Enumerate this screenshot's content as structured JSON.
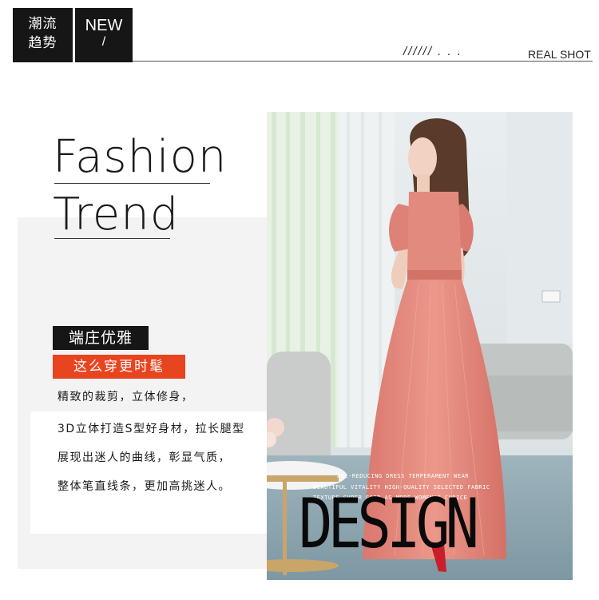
{
  "header": {
    "cn_tag_line1": "潮流",
    "cn_tag_line2": "趋势",
    "new_label": "NEW",
    "slash": "/",
    "dots": "////// . . .",
    "real_shot": "REAL SHOT"
  },
  "title": {
    "line1": "Fashion",
    "line2": "Trend"
  },
  "tags": {
    "black": "端庄优雅",
    "red": "这么穿更时髦"
  },
  "description": [
    "精致的裁剪，立体修身，",
    "3D立体打造S型好身材，拉长腿型",
    "展现出迷人的曲线，彰显气质，",
    "整体笔直线条，更加高挑迷人。"
  ],
  "photo": {
    "small_text": [
      "AGE-REDUCING DRESS  TEMPERAMENT WEAR",
      "BEAUTIFUL VITALITY  HIGH-QUALITY SELECTED FABRIC",
      "TEXTURE SUPER GOOD  AS MORE WOMEN'S CHOICE"
    ],
    "design_word": "DESIGN"
  },
  "colors": {
    "accent_red": "#e94420",
    "black": "#161616",
    "dress": "#e38a7f",
    "panel_grey": "#f3f3f3"
  }
}
